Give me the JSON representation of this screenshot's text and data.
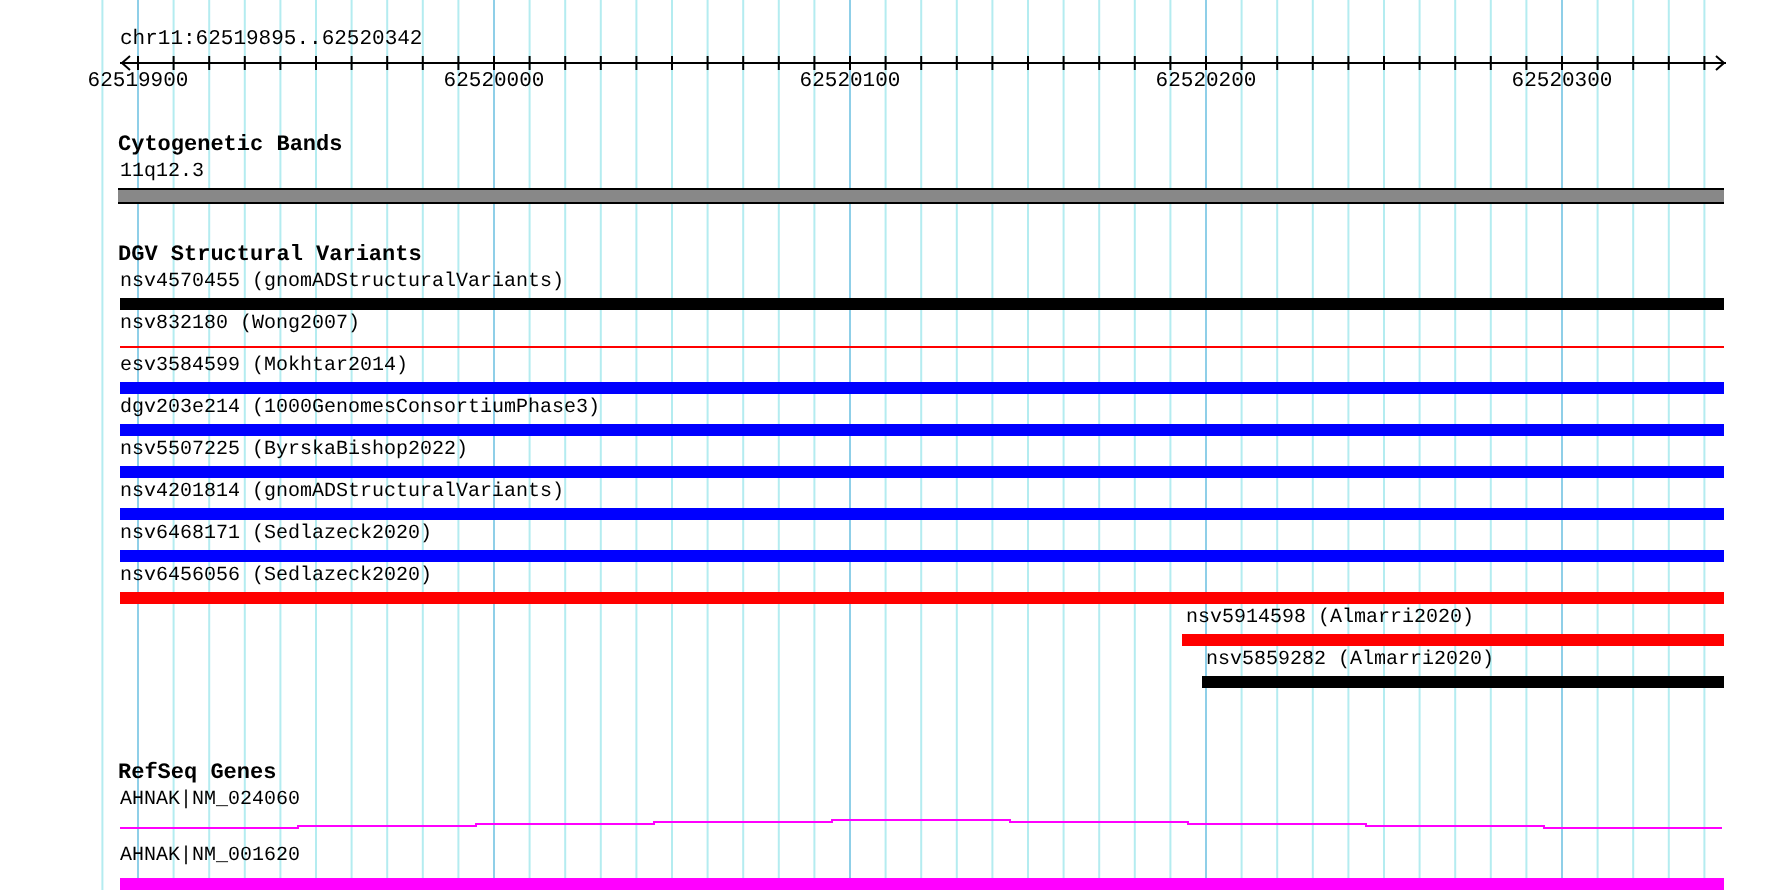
{
  "ruler": {
    "title": "chr11:62519895..62520342",
    "ticks": [
      "62519900",
      "62520000",
      "62520100",
      "62520200",
      "62520300"
    ]
  },
  "cytogenetic": {
    "title": "Cytogenetic Bands",
    "band": "11q12.3"
  },
  "dgv": {
    "title": "DGV Structural Variants",
    "features": [
      {
        "label": "nsv4570455 (gnomADStructuralVariants)",
        "color": "#000000",
        "kind": "thick"
      },
      {
        "label": "nsv832180 (Wong2007)",
        "color": "#ff0000",
        "kind": "thin"
      },
      {
        "label": "esv3584599 (Mokhtar2014)",
        "color": "#0000ff",
        "kind": "thick"
      },
      {
        "label": "dgv203e214 (1000GenomesConsortiumPhase3)",
        "color": "#0000ff",
        "kind": "thick"
      },
      {
        "label": "nsv5507225 (ByrskaBishop2022)",
        "color": "#0000ff",
        "kind": "thick"
      },
      {
        "label": "nsv4201814 (gnomADStructuralVariants)",
        "color": "#0000ff",
        "kind": "thick"
      },
      {
        "label": "nsv6468171 (Sedlazeck2020)",
        "color": "#0000ff",
        "kind": "thick"
      },
      {
        "label": "nsv6456056 (Sedlazeck2020)",
        "color": "#ff0000",
        "kind": "thick"
      },
      {
        "label": "nsv5914598 (Almarri2020)",
        "color": "#ff0000",
        "kind": "thick"
      },
      {
        "label": "nsv5859282 (Almarri2020)",
        "color": "#000000",
        "kind": "thick"
      }
    ]
  },
  "refseq": {
    "title": "RefSeq Genes",
    "transcripts": [
      {
        "label": "AHNAK|NM_024060",
        "kind": "line"
      },
      {
        "label": "AHNAK|NM_001620",
        "kind": "bar"
      }
    ]
  }
}
